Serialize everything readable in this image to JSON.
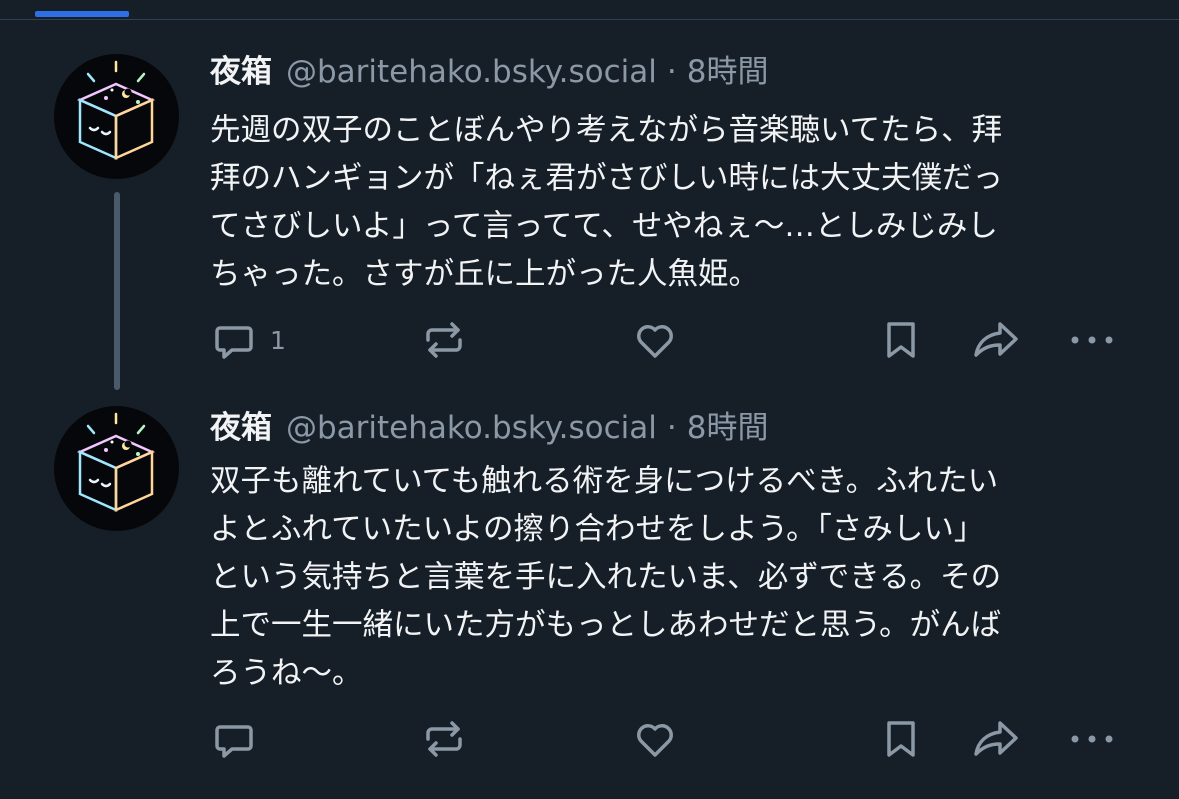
{
  "colors": {
    "background": "#161e27",
    "accent": "#2f6fe5",
    "text_primary": "#f1f3f5",
    "text_secondary": "#8b98a6",
    "thread_line": "#4b5a6b"
  },
  "icons": [
    "reply-icon",
    "repost-icon",
    "like-icon",
    "bookmark-icon",
    "share-icon",
    "more-icon"
  ],
  "posts": [
    {
      "author": "夜箱",
      "handle": "@baritehako.bsky.social",
      "separator": "·",
      "time": "8時間",
      "lines": [
        "先週の双子のことぼんやり考えながら音楽聴いてたら、拜",
        "拜のハンギョンが「ねぇ君がさびしい時には大丈夫僕だっ",
        "てさびしいよ」って言ってて、せやねぇ〜…としみじみし",
        "ちゃった。さすが丘に上がった人魚姫。"
      ],
      "reply_count": "1"
    },
    {
      "author": "夜箱",
      "handle": "@baritehako.bsky.social",
      "separator": "·",
      "time": "8時間",
      "lines": [
        "双子も離れていても触れる術を身につけるべき。ふれたい",
        "よとふれていたいよの擦り合わせをしよう。「さみしい」",
        "という気持ちと言葉を手に入れたいま、必ずできる。その",
        "上で一生一緒にいた方がもっとしあわせだと思う。がんば",
        "ろうね〜。"
      ]
    }
  ]
}
